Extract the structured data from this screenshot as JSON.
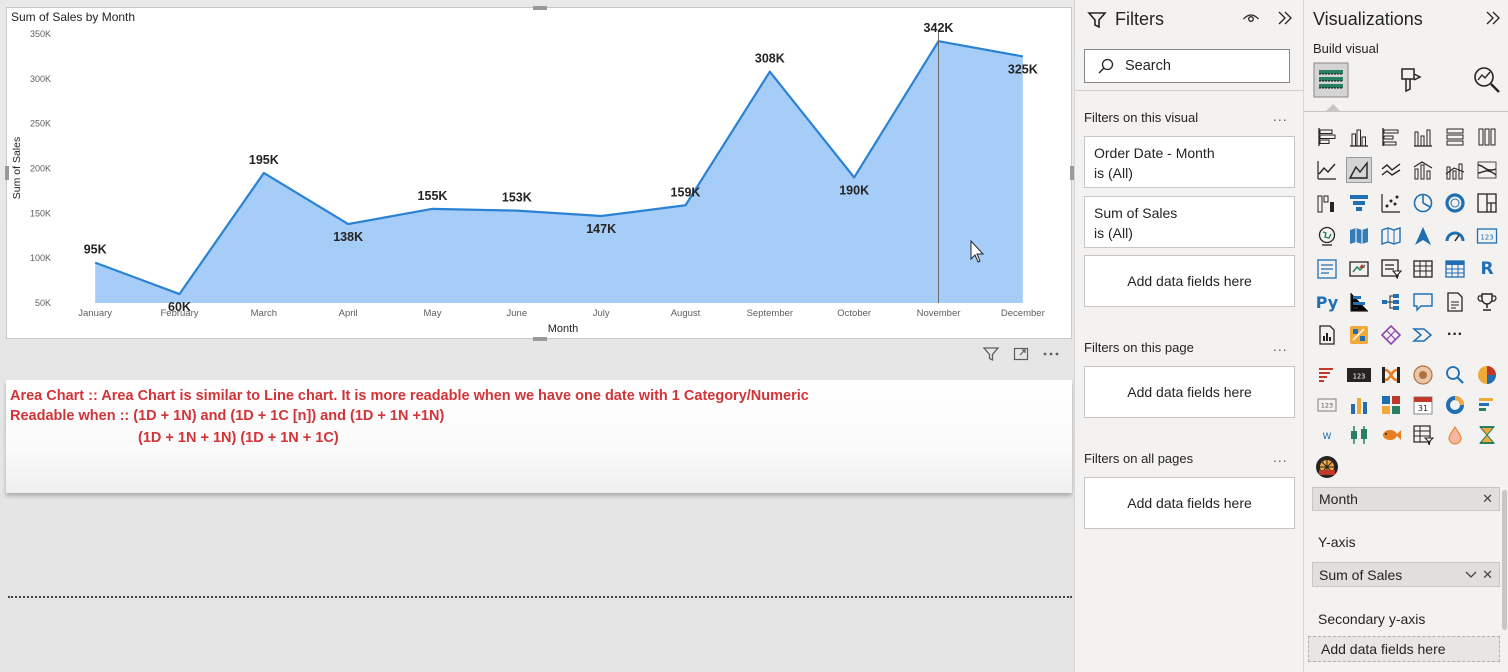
{
  "chart_data": {
    "type": "area",
    "title": "Sum of Sales by Month",
    "xlabel": "Month",
    "ylabel": "Sum of Sales",
    "categories": [
      "January",
      "February",
      "March",
      "April",
      "May",
      "June",
      "July",
      "August",
      "September",
      "October",
      "November",
      "December"
    ],
    "values": [
      95000,
      60000,
      195000,
      138000,
      155000,
      153000,
      147000,
      159000,
      308000,
      190000,
      342000,
      325000
    ],
    "data_labels": [
      "95K",
      "60K",
      "195K",
      "138K",
      "155K",
      "153K",
      "147K",
      "159K",
      "308K",
      "190K",
      "342K",
      "325K"
    ],
    "y_ticks": [
      "50K",
      "100K",
      "150K",
      "200K",
      "250K",
      "300K",
      "350K"
    ],
    "y_tick_values": [
      50000,
      100000,
      150000,
      200000,
      250000,
      300000,
      350000
    ],
    "ylim": [
      50000,
      350000
    ],
    "grid": false,
    "colors": {
      "fill": "#a5cdf7",
      "line": "#2a82d4"
    }
  },
  "text_box": {
    "line1": "Area Chart :: Area Chart is similar to Line chart. It is more readable when we have one date with 1 Category/Numeric",
    "line2": "Readable when :: (1D  + 1N) and (1D + 1C [n]) and (1D + 1N +1N)",
    "line3": "(1D + 1N + 1N) (1D + 1N + 1C)",
    "color": "#d13438"
  },
  "filters": {
    "title": "Filters",
    "search_placeholder": "Search",
    "on_visual_label": "Filters on this visual",
    "cards": [
      {
        "line1": "Order Date - Month",
        "line2": "is (All)"
      },
      {
        "line1": "Sum of Sales",
        "line2": "is (All)"
      }
    ],
    "add_fields": "Add data fields here",
    "on_page_label": "Filters on this page",
    "on_all_pages_label": "Filters on all pages",
    "more": "..."
  },
  "visualizations": {
    "title": "Visualizations",
    "build_visual": "Build visual",
    "x_axis_field": "Month",
    "y_axis_label": "Y-axis",
    "y_axis_field": "Sum of Sales",
    "secondary_y_label": "Secondary y-axis",
    "secondary_drop": "Add data fields here",
    "py_label": "Py",
    "r_label": "R",
    "more_label": "···"
  }
}
